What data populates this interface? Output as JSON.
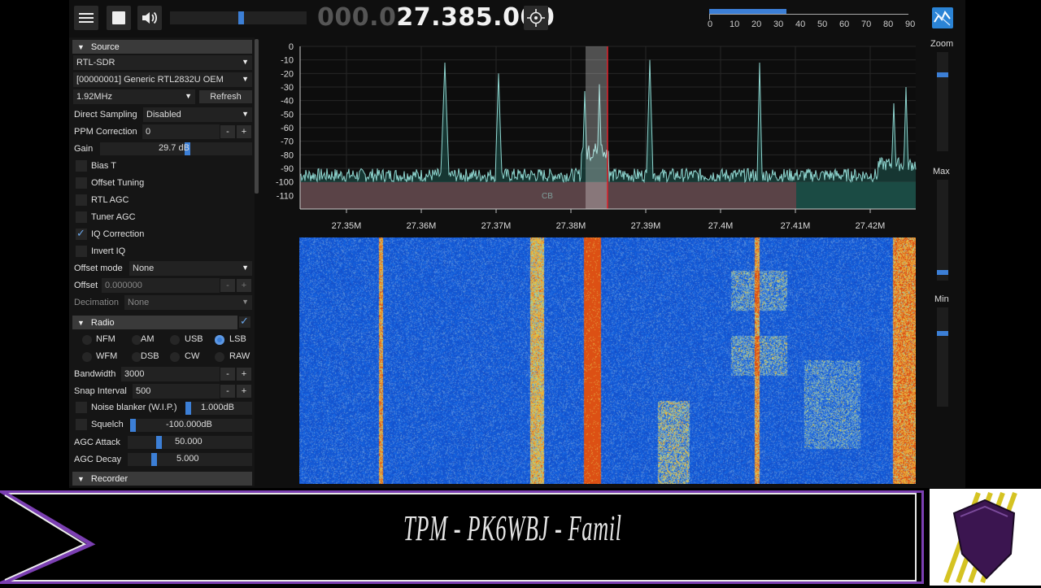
{
  "toolbar": {
    "menu_icon": "hamburger-icon",
    "play_icon": "stop-icon",
    "volume_icon": "speaker-icon",
    "volume_level": 0.52,
    "freq_dim": "000.0",
    "freq_bright": "27.385.000",
    "center_icon": "crosshair-icon",
    "snr_level": 35,
    "snr_ticks": [
      "0",
      "10",
      "20",
      "30",
      "40",
      "50",
      "60",
      "70",
      "80",
      "90"
    ],
    "logo_icon": "sdrpp-logo-icon"
  },
  "source": {
    "header": "Source",
    "device_type": "RTL-SDR",
    "device": "[00000001] Generic RTL2832U OEM",
    "sample_rate": "1.92MHz",
    "refresh": "Refresh",
    "direct_sampling_label": "Direct Sampling",
    "direct_sampling": "Disabled",
    "ppm_label": "PPM Correction",
    "ppm": "0",
    "gain_label": "Gain",
    "gain": "29.7 dB",
    "gain_level": 0.58,
    "bias_t": "Bias T",
    "offset_tuning": "Offset Tuning",
    "rtl_agc": "RTL AGC",
    "tuner_agc": "Tuner AGC",
    "iq_correction": "IQ Correction",
    "invert_iq": "Invert IQ",
    "offset_mode_label": "Offset mode",
    "offset_mode": "None",
    "offset_label": "Offset",
    "offset": "0.000000",
    "decimation_label": "Decimation",
    "decimation": "None",
    "minus": "-",
    "plus": "+"
  },
  "radio": {
    "header": "Radio",
    "modes": [
      "NFM",
      "AM",
      "USB",
      "LSB",
      "WFM",
      "DSB",
      "CW",
      "RAW"
    ],
    "selected_mode": "LSB",
    "bandwidth_label": "Bandwidth",
    "bandwidth": "3000",
    "snap_label": "Snap Interval",
    "snap": "500",
    "noise_blanker": "Noise blanker (W.I.P.)",
    "noise_blanker_value": "1.000dB",
    "squelch": "Squelch",
    "squelch_value": "-100.000dB",
    "agc_attack_label": "AGC Attack",
    "agc_attack": "50.000",
    "agc_decay_label": "AGC Decay",
    "agc_decay": "5.000"
  },
  "recorder": {
    "header": "Recorder"
  },
  "spectrum": {
    "y_ticks": [
      "0",
      "-10",
      "-20",
      "-30",
      "-40",
      "-50",
      "-60",
      "-70",
      "-80",
      "-90",
      "-100",
      "-110"
    ],
    "x_ticks": [
      "27.35M",
      "27.36M",
      "27.37M",
      "27.38M",
      "27.39M",
      "27.4M",
      "27.41M",
      "27.42M"
    ],
    "band_label": "CB",
    "band_color": "#a3283a",
    "trace_color": "#8fd6d0"
  },
  "right": {
    "zoom": "Zoom",
    "max": "Max",
    "min": "Min"
  },
  "banner": {
    "text": "TPM - PK6WBJ - Famil",
    "accent": "#7b3fb2"
  }
}
